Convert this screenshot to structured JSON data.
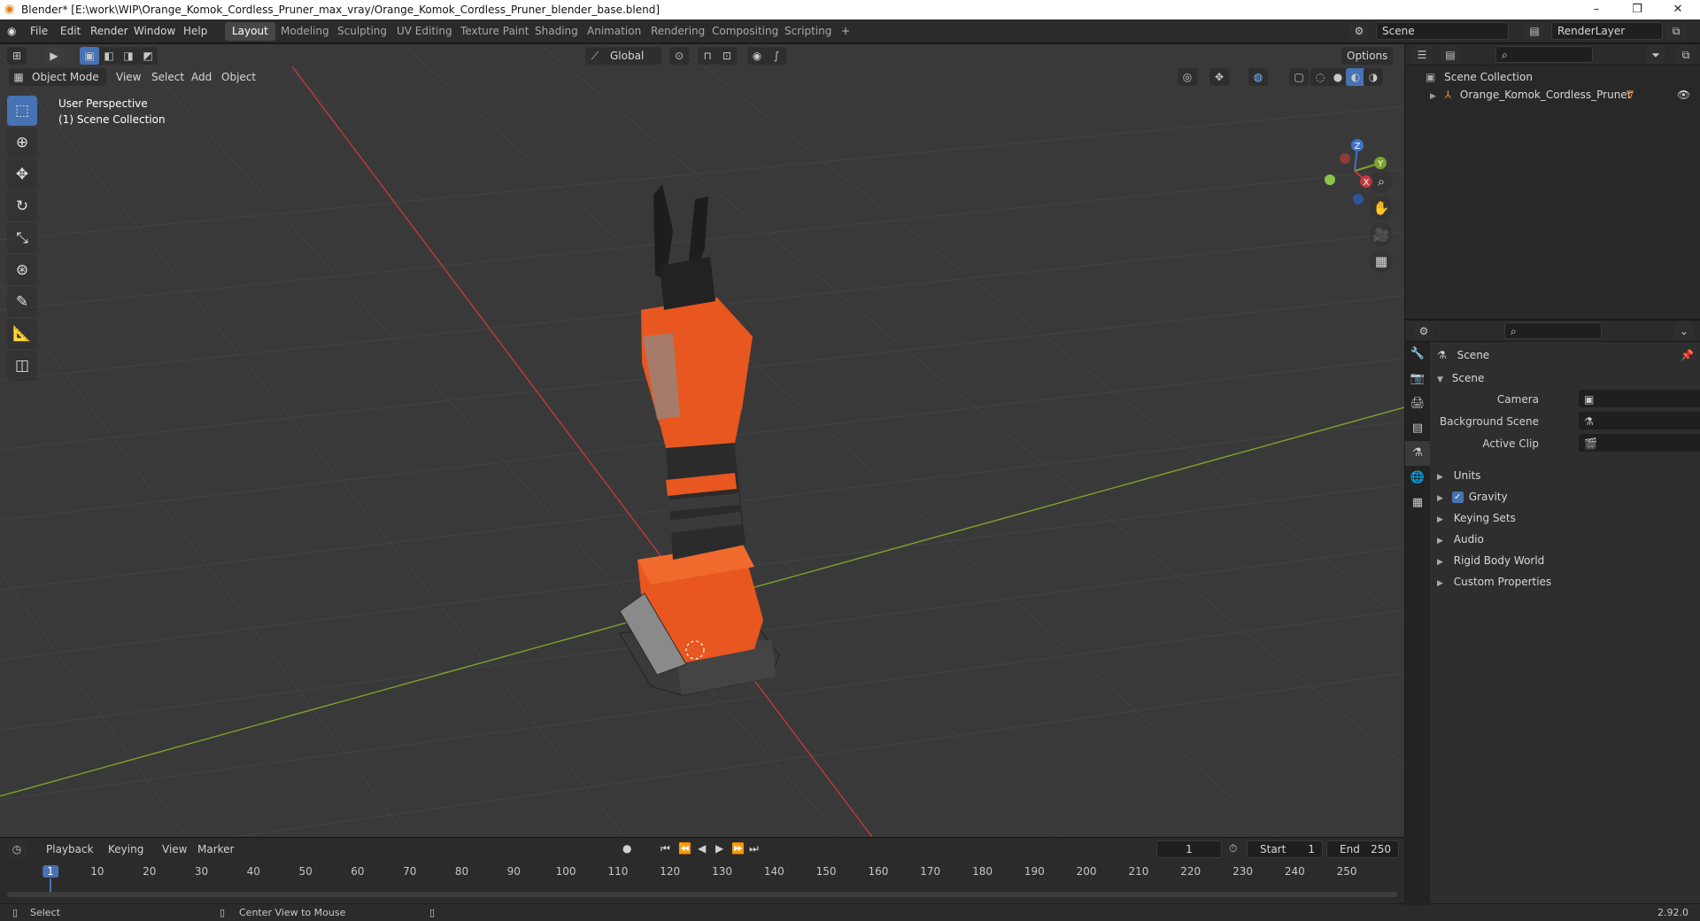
{
  "window": {
    "title": "Blender* [E:\\work\\WIP\\Orange_Komok_Cordless_Pruner_max_vray/Orange_Komok_Cordless_Pruner_blender_base.blend]",
    "minimize": "–",
    "maximize": "❐",
    "close": "✕"
  },
  "menu": [
    "File",
    "Edit",
    "Render",
    "Window",
    "Help"
  ],
  "workspaces": [
    "Layout",
    "Modeling",
    "Sculpting",
    "UV Editing",
    "Texture Paint",
    "Shading",
    "Animation",
    "Rendering",
    "Compositing",
    "Scripting"
  ],
  "workspace_add": "+",
  "scene_field": "Scene",
  "render_layer_field": "RenderLayer",
  "viewport": {
    "mode": "Object Mode",
    "menus": [
      "View",
      "Select",
      "Add",
      "Object"
    ],
    "transform_orientation": "Global",
    "options_label": "Options",
    "overlay_line1": "User Perspective",
    "overlay_line2": "(1) Scene Collection",
    "gizmo_axes": {
      "z": "Z",
      "y": "Y",
      "x": "X"
    }
  },
  "outliner": {
    "root": "Scene Collection",
    "object": "Orange_Komok_Cordless_Pruner"
  },
  "properties": {
    "context_title": "Scene",
    "panel_title": "Scene",
    "fields": {
      "camera": "Camera",
      "background_scene": "Background Scene",
      "active_clip": "Active Clip"
    },
    "sections": [
      "Units",
      "Gravity",
      "Keying Sets",
      "Audio",
      "Rigid Body World",
      "Custom Properties"
    ],
    "gravity_checked": true
  },
  "timeline": {
    "menus": [
      "Playback",
      "Keying",
      "View",
      "Marker"
    ],
    "current_frame": "1",
    "start_label": "Start",
    "start_value": "1",
    "end_label": "End",
    "end_value": "250",
    "ticks": [
      "1",
      "10",
      "20",
      "30",
      "40",
      "50",
      "60",
      "70",
      "80",
      "90",
      "100",
      "110",
      "120",
      "130",
      "140",
      "150",
      "160",
      "170",
      "180",
      "190",
      "200",
      "210",
      "220",
      "230",
      "240",
      "250"
    ]
  },
  "statusbar": {
    "left": "Select",
    "middle": "Center View to Mouse",
    "version": "2.92.0"
  },
  "colors": {
    "accent": "#4772b3",
    "x_axis": "#c2383f",
    "y_axis": "#7da32a",
    "object_orange": "#e8571f"
  }
}
